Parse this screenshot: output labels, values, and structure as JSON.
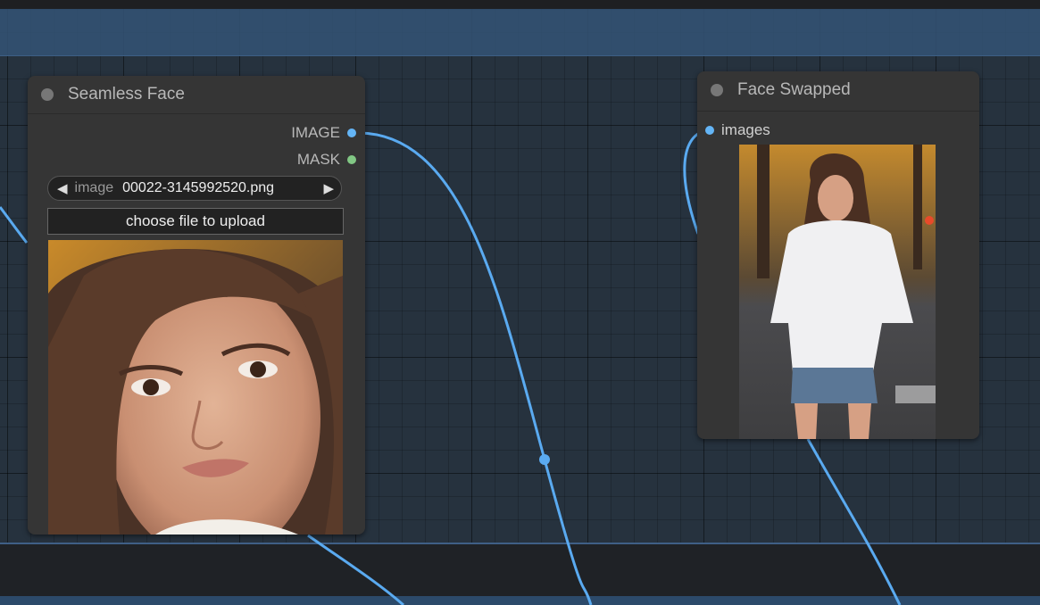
{
  "nodes": {
    "seamless_face": {
      "title": "Seamless Face",
      "outputs": [
        {
          "label": "IMAGE",
          "color": "#64b5f6"
        },
        {
          "label": "MASK",
          "color": "#81c784"
        }
      ],
      "image_widget": {
        "label": "image",
        "value": "00022-3145992520.png",
        "prev_arrow": "◀",
        "next_arrow": "▶"
      },
      "upload_label": "choose file to upload"
    },
    "face_swapped": {
      "title": "Face Swapped",
      "inputs": [
        {
          "label": "images",
          "color": "#64b5f6"
        }
      ]
    }
  },
  "colors": {
    "link": "#5aaaf0",
    "group_band": "#34547a",
    "canvas": "#26323e",
    "node_bg": "#353535"
  },
  "icons": [
    "collapse-dot-icon",
    "prev-arrow-icon",
    "next-arrow-icon"
  ]
}
